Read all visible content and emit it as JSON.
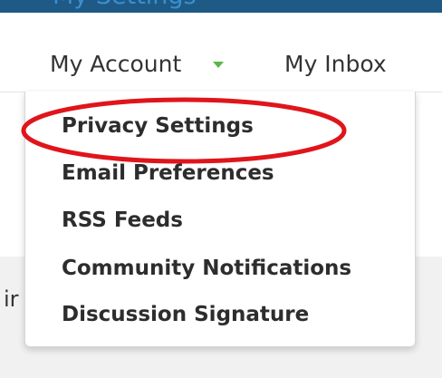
{
  "header": {
    "banner_text": "My Settings"
  },
  "nav": {
    "account_label": "My Account",
    "inbox_label": "My Inbox"
  },
  "dropdown": {
    "items": [
      {
        "label": "Privacy Settings"
      },
      {
        "label": "Email Preferences"
      },
      {
        "label": "RSS Feeds"
      },
      {
        "label": "Community Notifications"
      },
      {
        "label": "Discussion Signature"
      }
    ]
  },
  "content": {
    "fragment": "ir"
  },
  "colors": {
    "banner": "#1e5a85",
    "caret": "#58b847",
    "highlight_ellipse": "#e0151b"
  }
}
